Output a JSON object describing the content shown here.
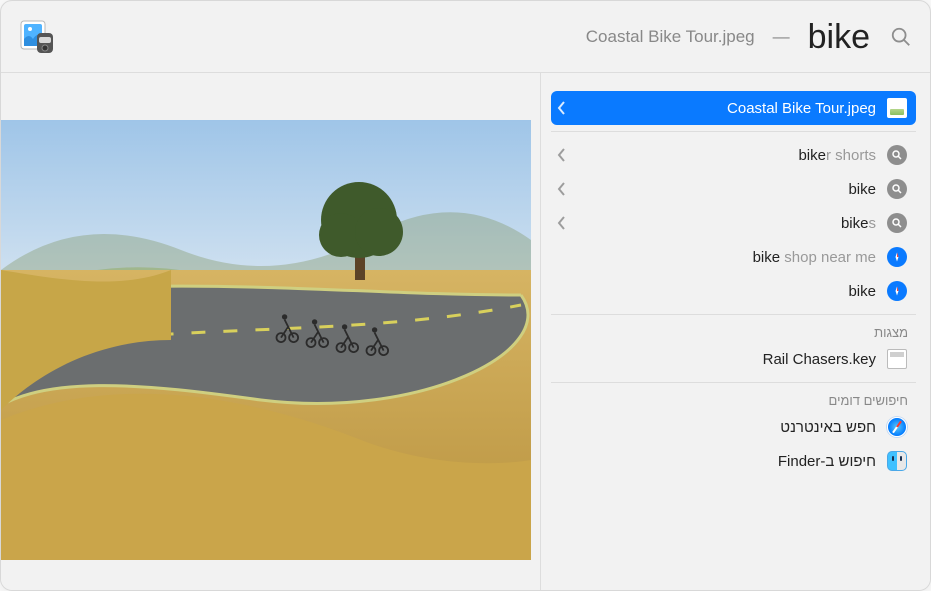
{
  "search": {
    "query": "bike"
  },
  "title": {
    "filename": "Coastal Bike Tour.jpeg",
    "sep": "—"
  },
  "results": {
    "primary": {
      "label": "Coastal Bike Tour.jpeg"
    },
    "suggestions": [
      {
        "match": "bike",
        "rest": "r shorts",
        "kind": "search",
        "chev": true
      },
      {
        "match": "bike",
        "rest": "",
        "kind": "search",
        "chev": true
      },
      {
        "match": "bike",
        "rest": "s",
        "kind": "search",
        "chev": true
      },
      {
        "match": "bike",
        "rest": " shop near me",
        "kind": "safari-circle",
        "chev": false
      },
      {
        "match": "bike",
        "rest": "",
        "kind": "safari-circle",
        "chev": false
      }
    ]
  },
  "sections": {
    "presentations": {
      "label": "מצגות",
      "items": [
        {
          "label": "Rail Chasers.key"
        }
      ]
    },
    "similar": {
      "label": "חיפושים דומים",
      "items": [
        {
          "label": "חפש באינטרנט",
          "kind": "safari"
        },
        {
          "label": "חיפוש ב-Finder",
          "kind": "finder"
        }
      ]
    }
  }
}
